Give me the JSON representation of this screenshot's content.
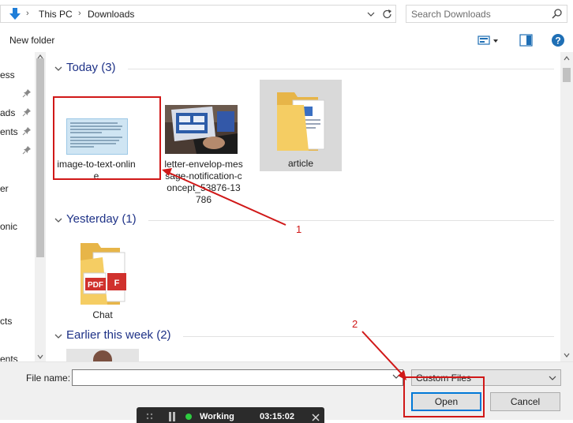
{
  "address_bar": {
    "breadcrumbs": [
      "This PC",
      "Downloads"
    ],
    "search_placeholder": "Search Downloads"
  },
  "command_bar": {
    "new_folder_label": "New folder"
  },
  "nav_pane": {
    "items": [
      {
        "label": "ess",
        "pinned": false
      },
      {
        "label": "ads",
        "pinned": true
      },
      {
        "label": "ents",
        "pinned": true
      },
      {
        "label": "",
        "pinned": true
      },
      {
        "label": "er",
        "pinned": false
      },
      {
        "label": "onic",
        "pinned": false
      },
      {
        "label": "cts",
        "pinned": false
      },
      {
        "label": "ents",
        "pinned": false
      }
    ]
  },
  "groups": [
    {
      "title": "Today (3)",
      "items": [
        {
          "name": "image-to-text-online",
          "type": "document-thumbnail",
          "selected": false
        },
        {
          "name": "letter-envelop-message-notification-concept_53876-13786",
          "type": "photo-thumbnail",
          "selected": false
        },
        {
          "name": "article",
          "type": "folder",
          "selected": true
        }
      ]
    },
    {
      "title": "Yesterday (1)",
      "items": [
        {
          "name": "Chat",
          "type": "pdf-folder",
          "selected": false
        }
      ]
    },
    {
      "title": "Earlier this week (2)",
      "items": []
    }
  ],
  "bottom_bar": {
    "file_name_label": "File name:",
    "file_name_value": "",
    "filter_value": "Custom Files",
    "open_label": "Open",
    "cancel_label": "Cancel"
  },
  "recording_toolbar": {
    "status": "Working",
    "timer": "03:15:02"
  },
  "annotations": {
    "label_1": "1",
    "label_2": "2",
    "color": "#d01818"
  },
  "colors": {
    "group_title": "#1e3287",
    "selection": "#d9d9d9",
    "accent": "#0078d7",
    "folder": "#f5c85c"
  }
}
